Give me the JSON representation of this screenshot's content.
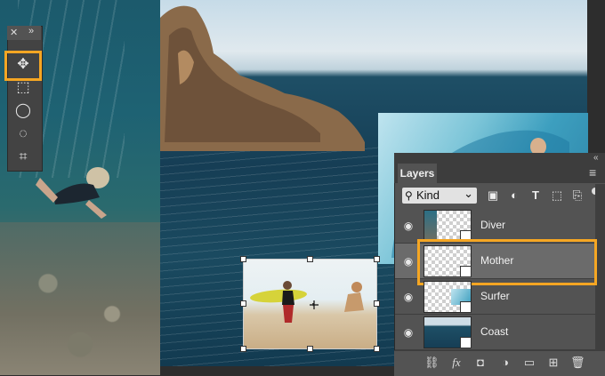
{
  "tools_panel": {
    "close_glyph": "✕",
    "collapse_glyph": "»",
    "tools": [
      {
        "name": "move-tool",
        "icon": "move-icon",
        "glyph": "✥"
      },
      {
        "name": "marquee-tool",
        "icon": "rectangular-marquee-icon",
        "glyph": "⬚"
      },
      {
        "name": "lasso-tool",
        "icon": "lasso-icon",
        "glyph": "◯"
      },
      {
        "name": "quick-selection-tool",
        "icon": "quick-selection-icon",
        "glyph": "◌"
      },
      {
        "name": "crop-tool",
        "icon": "crop-icon",
        "glyph": "⌗"
      }
    ],
    "selected_tool": "move-tool",
    "highlight_color": "#f5a623"
  },
  "layers_panel": {
    "title": "Layers",
    "collapse_glyph": "«",
    "menu_glyph": "≡",
    "filter": {
      "search_glyph": "⚲",
      "kind_label": "Kind",
      "dropdown_glyph": "⌄",
      "filter_icons": [
        "image-filter-icon",
        "adjustment-filter-icon",
        "type-filter-icon",
        "shape-filter-icon",
        "smart-object-filter-icon"
      ],
      "filter_glyphs": [
        "▣",
        "◐",
        "T",
        "⬚",
        "⎘"
      ]
    },
    "layers": [
      {
        "name": "Diver",
        "visible": true,
        "selected": false
      },
      {
        "name": "Mother",
        "visible": true,
        "selected": true
      },
      {
        "name": "Surfer",
        "visible": true,
        "selected": false
      },
      {
        "name": "Coast",
        "visible": true,
        "selected": false
      }
    ],
    "eye_glyph": "◉",
    "bottom_icons": [
      "link-layers-icon",
      "fx-icon",
      "add-mask-icon",
      "adjustment-layer-icon",
      "new-group-icon",
      "new-layer-icon",
      "delete-layer-icon"
    ],
    "bottom_glyphs": [
      "⛓",
      "fx",
      "◘",
      "◑",
      "▭",
      "⊞",
      "🗑"
    ],
    "highlight_color": "#f5a623"
  }
}
